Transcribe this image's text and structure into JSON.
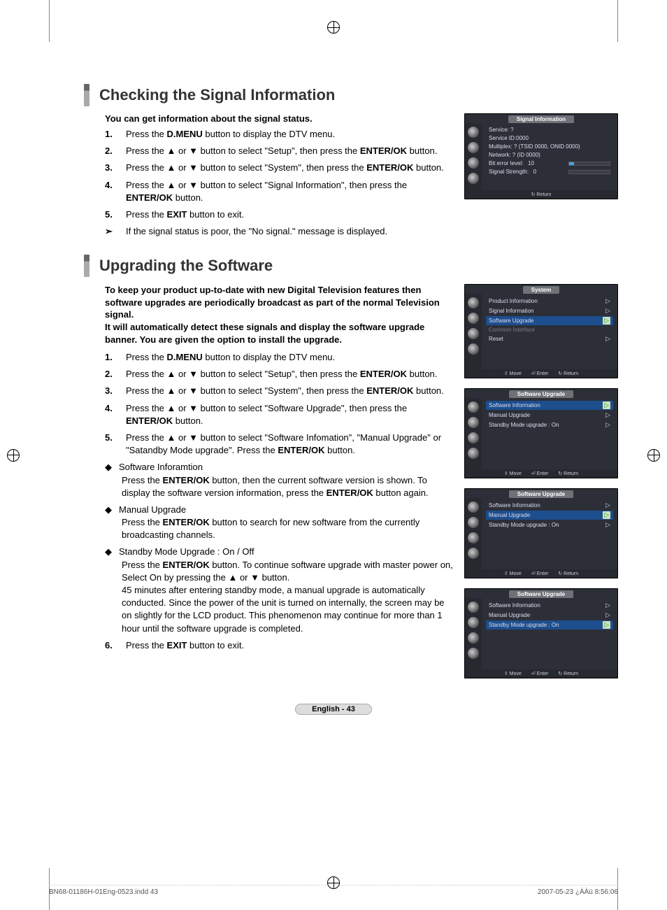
{
  "sections": {
    "check": {
      "title": "Checking the Signal Information",
      "lead": "You can get information about the signal status.",
      "steps": [
        "Press the <b>D.MENU</b> button to display the DTV menu.",
        "Press the ▲ or ▼ button to select \"Setup\", then press the <b>ENTER/OK</b> button.",
        "Press the ▲ or ▼ button to select \"System\", then press the <b>ENTER/OK</b> button.",
        "Press the ▲ or ▼ button to select \"Signal Information\", then press the <b>ENTER/OK</b> button.",
        "Press the <b>EXIT</b> button to exit."
      ],
      "note": "If the signal status is poor, the \"No signal.\" message is displayed."
    },
    "upgrade": {
      "title": "Upgrading the Software",
      "intro": "To keep your product up-to-date with new Digital Television features then software upgrades are periodically broadcast as part of the normal Television signal.\nIt will automatically detect these signals and display the software upgrade banner. You are given the option to install the upgrade.",
      "steps": [
        "Press the <b>D.MENU</b> button to display the DTV menu.",
        "Press the ▲ or ▼ button to select \"Setup\", then press the <b>ENTER/OK</b> button.",
        "Press the ▲ or ▼ button to select \"System\", then press the <b>ENTER/OK</b> button.",
        "Press the ▲ or ▼ button to select \"Software Upgrade\", then press the <b>ENTER/OK</b> button.",
        "Press the ▲ or ▼ button to select \"Software Infomation\", \"Manual Upgrade\" or \"Satandby Mode upgrade\". Press the <b>ENTER/OK</b> button."
      ],
      "bullets": [
        {
          "title": "Software Inforamtion",
          "body": "Press the <b>ENTER/OK</b> button, then the current software version is shown. To display the software version information, press the <b>ENTER/OK</b> button again."
        },
        {
          "title": "Manual Upgrade",
          "body": "Press the <b>ENTER/OK</b> button to search for new software from the currently broadcasting channels."
        },
        {
          "title": "Standby Mode Upgrade : On / Off",
          "body": "Press the <b>ENTER/OK</b> button. To continue software upgrade with master power on, Select On by pressing the ▲ or ▼ button.\n45 minutes after entering standby mode, a manual upgrade is automatically conducted. Since the power of the unit is turned on internally, the screen may be on slightly for the LCD product. This phenomenon may continue for more than 1 hour until the software upgrade is completed."
        }
      ],
      "step6": "Press the <b>EXIT</b> button to exit."
    }
  },
  "osd": {
    "signal_info": {
      "title": "Signal Information",
      "rows": [
        "Service: ?",
        "Service ID:0000",
        "Multiplex: ? (TSID 0000, ONID 0000)",
        "Network: ? (ID 0000)"
      ],
      "bit_label": "Bit error level:",
      "bit_value": "10",
      "bit_pct": 12,
      "sig_label": "Signal Strength:",
      "sig_value": "0",
      "sig_pct": 0,
      "footer_return": "Return"
    },
    "system": {
      "title": "System",
      "rows": [
        {
          "label": "Product Information",
          "sel": false,
          "dim": false,
          "arrow": true
        },
        {
          "label": "Signal Information",
          "sel": false,
          "dim": false,
          "arrow": true
        },
        {
          "label": "Software Upgrade",
          "sel": true,
          "dim": false,
          "arrow": true
        },
        {
          "label": "Common Interface",
          "sel": false,
          "dim": true,
          "arrow": false
        },
        {
          "label": "Reset",
          "sel": false,
          "dim": false,
          "arrow": true
        }
      ],
      "footer": {
        "move": "Move",
        "enter": "Enter",
        "return": "Return"
      }
    },
    "sw_upgrade": {
      "title": "Software Upgrade",
      "rows": [
        {
          "label": "Software Information",
          "arrow": true
        },
        {
          "label": "Manual Upgrade",
          "arrow": true
        },
        {
          "label": "Standby Mode upgrade : On",
          "arrow": true
        }
      ],
      "footer": {
        "move": "Move",
        "enter": "Enter",
        "return": "Return"
      }
    },
    "sel_indices": [
      0,
      1,
      2
    ]
  },
  "page_badge": "English - 43",
  "footer": {
    "left": "BN68-01186H-01Eng-0523.indd   43",
    "right": "2007-05-23   ¿ÀÀü 8:56:06"
  }
}
